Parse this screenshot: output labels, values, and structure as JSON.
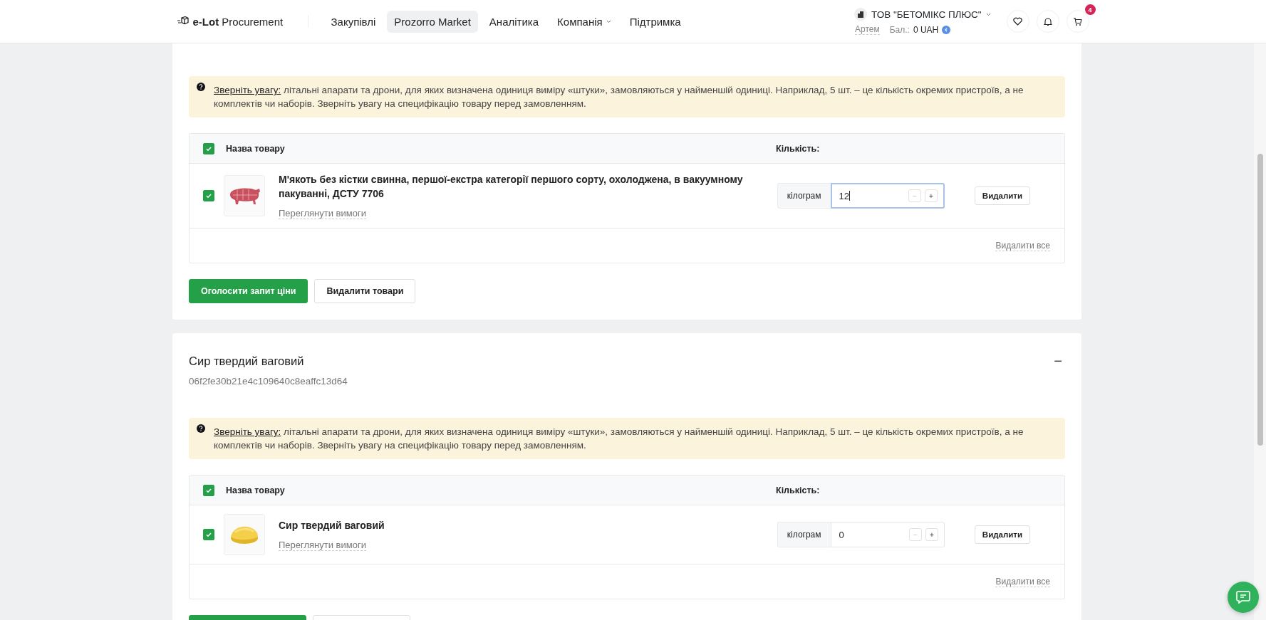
{
  "header": {
    "logo_bold": "e-Lot",
    "logo_rest": "Procurement",
    "nav": [
      {
        "label": "Закупівлі",
        "selected": false,
        "dropdown": false
      },
      {
        "label": "Prozorro Market",
        "selected": true,
        "dropdown": false
      },
      {
        "label": "Аналітика",
        "selected": false,
        "dropdown": false
      },
      {
        "label": "Компанія",
        "selected": false,
        "dropdown": true
      },
      {
        "label": "Підтримка",
        "selected": false,
        "dropdown": false
      }
    ],
    "company": "ТОВ \"БЕТОМІКС ПЛЮС\"",
    "user": "Артем",
    "balance_label": "Бал.:",
    "balance": "0 UAH",
    "cart_count": "4"
  },
  "cards": [
    {
      "alert": "**Зверніть увагу:** лiтальні апарати та дрони, для яких визначена одиниця виміру «штуки», замовляються у найменшій одиниці. Наприклад, 5 шт. – це кількість окремих пристроїв, а не комплектів чи наборів. Зверніть увагу на специфікацію товару перед замовленням.",
      "table": {
        "select_all": true,
        "col_name": "Назва товару",
        "col_qty": "Кількість:",
        "rows": [
          {
            "checked": true,
            "name": "М'якоть без кістки свинна, першої-екстра категорії першого сорту, охолоджена, в вакуумному пакуванні, ДСТУ 7706",
            "link": "Переглянути вимоги",
            "unit": "кілограм",
            "quantity": "12",
            "focused": true,
            "minus": "−",
            "plus": "+",
            "remove": "Видалити"
          }
        ],
        "remove_all": "Видалити все"
      },
      "actions": [
        {
          "kind": "primary",
          "label": "Оголосити запит ціни"
        },
        {
          "kind": "secondary",
          "label": "Видалити товари"
        }
      ]
    },
    {
      "title": "Сир твердий ваговий",
      "code": "06f2fe30b21e4c109640c8eaffc13d64",
      "collapse": "−",
      "alert": "**Зверніть увагу:** лiтальні апарати та дрони, для яких визначена одиниця виміру «штуки», замовляються у найменшій одиниці. Наприклад, 5 шт. – це кількість окремих пристроїв, а не комплектів чи наборів. Зверніть увагу на специфікацію товару перед замовленням.",
      "table": {
        "select_all": true,
        "col_name": "Назва товару",
        "col_qty": "Кількість:",
        "rows": [
          {
            "checked": true,
            "name": "Сир твердий ваговий",
            "link": "Переглянути вимоги",
            "unit": "кілограм",
            "quantity": "0",
            "focused": false,
            "minus": "−",
            "plus": "+",
            "remove": "Видалити"
          }
        ],
        "remove_all": "Видалити все"
      },
      "actions": [
        {
          "kind": "primary"
        },
        {
          "kind": "secondary"
        }
      ]
    }
  ]
}
